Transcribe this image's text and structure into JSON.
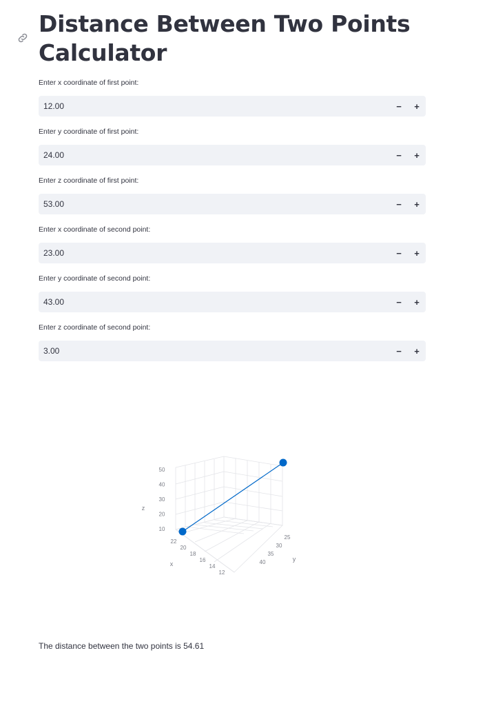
{
  "page": {
    "title": "Distance Between Two Points Calculator"
  },
  "inputs": [
    {
      "label": "Enter x coordinate of first point:",
      "value": "12.00",
      "minus": "−",
      "plus": "+"
    },
    {
      "label": "Enter y coordinate of first point:",
      "value": "24.00",
      "minus": "−",
      "plus": "+"
    },
    {
      "label": "Enter z coordinate of first point:",
      "value": "53.00",
      "minus": "−",
      "plus": "+"
    },
    {
      "label": "Enter x coordinate of second point:",
      "value": "23.00",
      "minus": "−",
      "plus": "+"
    },
    {
      "label": "Enter y coordinate of second point:",
      "value": "43.00",
      "minus": "−",
      "plus": "+"
    },
    {
      "label": "Enter z coordinate of second point:",
      "value": "3.00",
      "minus": "−",
      "plus": "+"
    }
  ],
  "chart_data": {
    "type": "scatter3d",
    "mode": "lines+markers",
    "points": [
      {
        "x": 12,
        "y": 24,
        "z": 53
      },
      {
        "x": 23,
        "y": 43,
        "z": 3
      }
    ],
    "color": "#0068c9",
    "axes": {
      "x": {
        "label": "x",
        "ticks": [
          "22",
          "20",
          "18",
          "16",
          "14",
          "12"
        ]
      },
      "y": {
        "label": "y",
        "ticks": [
          "25",
          "30",
          "35",
          "40"
        ]
      },
      "z": {
        "label": "z",
        "ticks": [
          "50",
          "40",
          "30",
          "20",
          "10"
        ]
      }
    },
    "grid": true
  },
  "result": {
    "text": "The distance between the two points is 54.61"
  },
  "colors": {
    "accent": "#0068c9",
    "input_bg": "#f0f2f6",
    "text": "#31333f"
  }
}
